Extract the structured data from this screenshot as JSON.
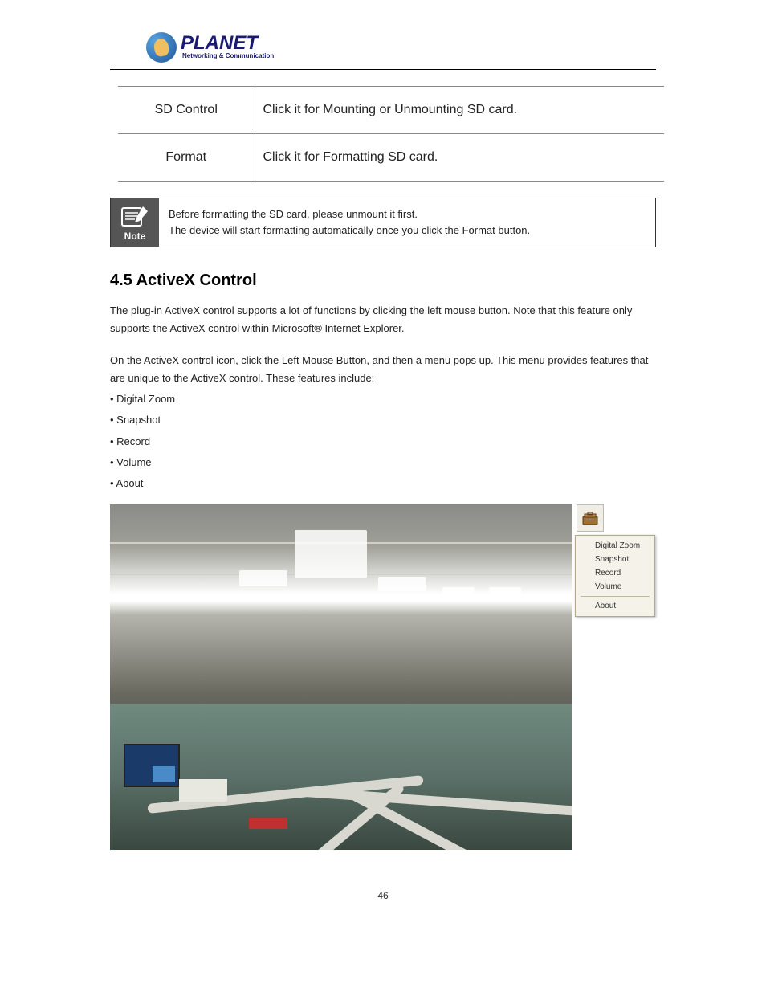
{
  "logo": {
    "brand": "PLANET",
    "tagline": "Networking & Communication"
  },
  "table": {
    "rows": [
      {
        "label": "SD Control",
        "desc": "Click it for Mounting or Unmounting SD card."
      },
      {
        "label": "Format",
        "desc": "Click it for Formatting SD card."
      }
    ]
  },
  "note": {
    "label": "Note",
    "text1": "Before formatting the SD card, please unmount it first.",
    "text2": "The device will start formatting automatically once you click the Format button."
  },
  "body": {
    "heading": "4.5 ActiveX Control",
    "para1": "The plug-in ActiveX control supports a lot of functions by clicking the left mouse button. Note that this feature only supports the ActiveX control within Microsoft® Internet Explorer.",
    "para2": "On the ActiveX control icon, click the Left Mouse Button, and then a menu pops up. This menu provides features that are unique to the ActiveX control. These features include:",
    "bullets": [
      "• Digital Zoom",
      "• Snapshot",
      "• Record",
      "• Volume",
      "• About"
    ]
  },
  "context_menu": {
    "items": [
      "Digital Zoom",
      "Snapshot",
      "Record",
      "Volume"
    ],
    "after_sep": [
      "About"
    ]
  },
  "page_number": "46"
}
